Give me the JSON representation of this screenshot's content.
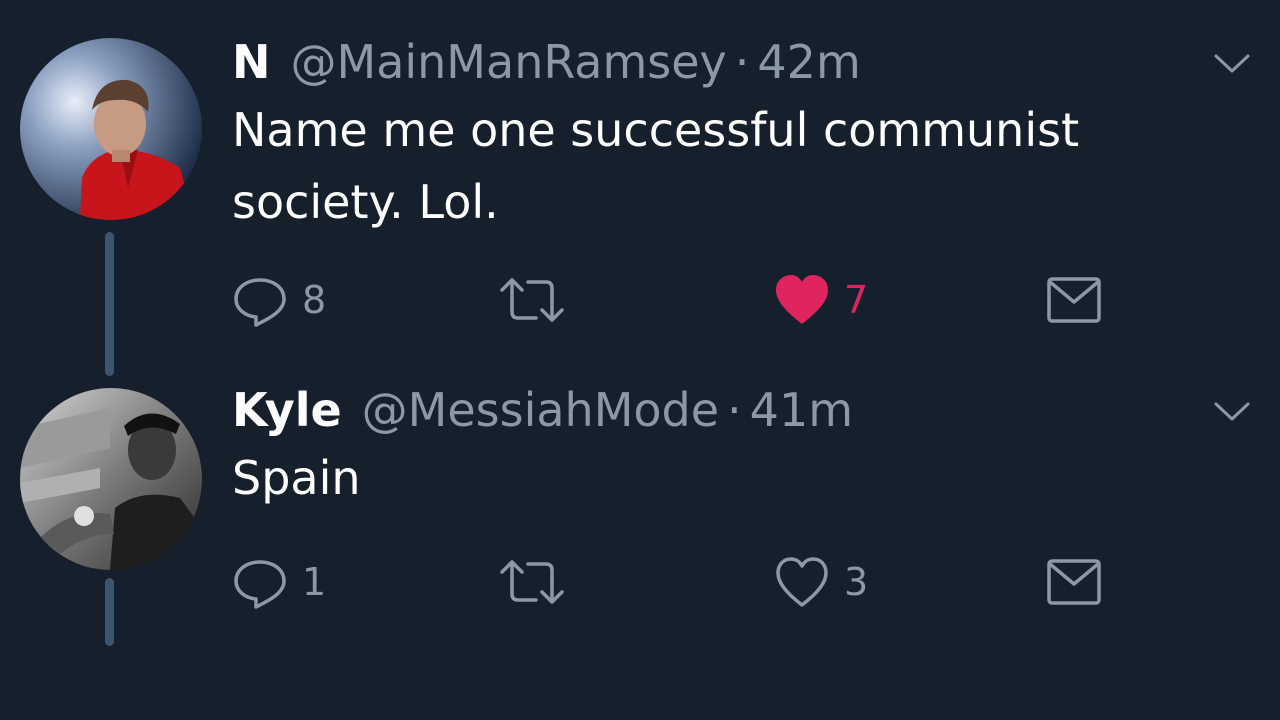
{
  "tweets": [
    {
      "display_name": "N",
      "handle": "@MainManRamsey",
      "separator": "·",
      "time": "42m",
      "text": "Name me one successful communist society. Lol.",
      "actions": {
        "reply_count": "8",
        "retweet_count": "",
        "like_count": "7",
        "liked": true
      },
      "icons": [
        "avatar",
        "reply-icon",
        "retweet-icon",
        "heart-filled-icon",
        "envelope-icon",
        "chevron-down-icon"
      ]
    },
    {
      "display_name": "Kyle",
      "handle": "@MessiahMode",
      "separator": "·",
      "time": "41m",
      "text": "Spain",
      "actions": {
        "reply_count": "1",
        "retweet_count": "",
        "like_count": "3",
        "liked": false
      },
      "icons": [
        "avatar",
        "reply-icon",
        "retweet-icon",
        "heart-outline-icon",
        "envelope-icon",
        "chevron-down-icon"
      ]
    }
  ],
  "colors": {
    "background": "#16202c",
    "text_primary": "#ffffff",
    "text_secondary": "#8b98a5",
    "like_active": "#e0245e",
    "thread_line": "#3b556e"
  }
}
